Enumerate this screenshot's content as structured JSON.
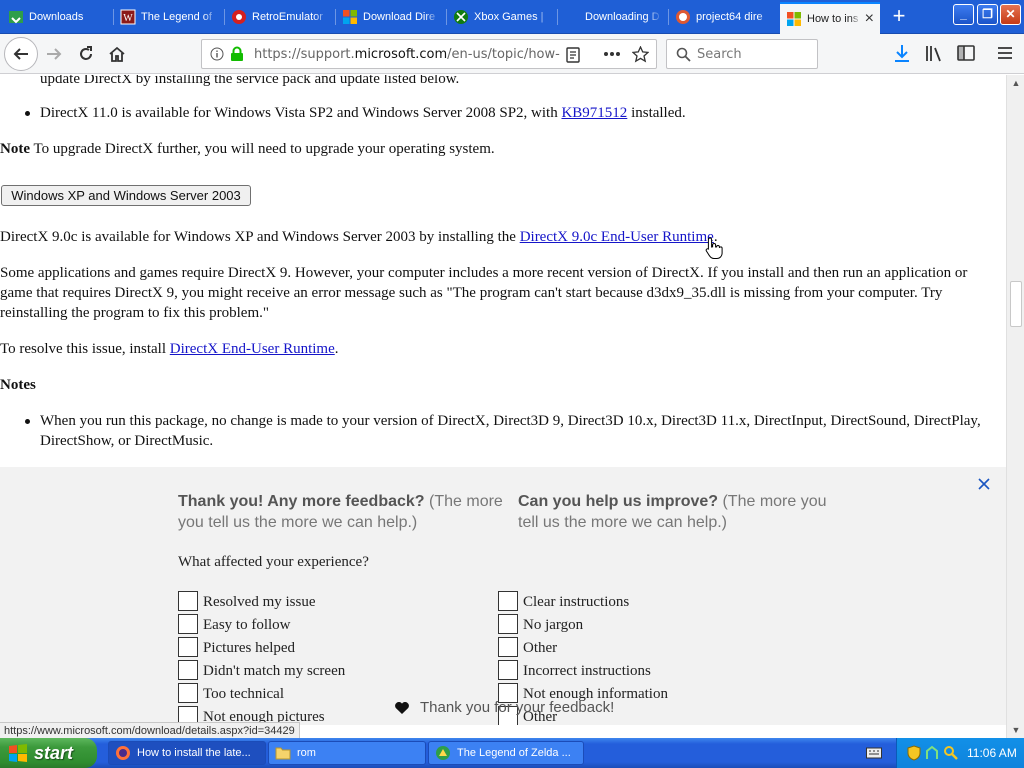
{
  "browser": {
    "tabs": [
      {
        "label": "Downloads",
        "icon": "downloads-favicon"
      },
      {
        "label": "The Legend of",
        "icon": "zelda-favicon"
      },
      {
        "label": "RetroEmulator",
        "icon": "retroemulator-favicon"
      },
      {
        "label": "Download Dire",
        "icon": "microsoft-favicon"
      },
      {
        "label": "Xbox Games |",
        "icon": "xbox-favicon"
      },
      {
        "label": "Downloading D",
        "icon": "blank-favicon"
      },
      {
        "label": "project64 dire",
        "icon": "duckduckgo-favicon"
      },
      {
        "label": "How to ins",
        "icon": "microsoft-favicon",
        "active": true
      }
    ],
    "tab_close": "×",
    "new_tab": "+",
    "window_buttons": {
      "minimize": "_",
      "maximize": "❐",
      "close": "✕"
    },
    "url_prefix": "https://support.",
    "url_domain": "microsoft.com",
    "url_path": "/en-us/topic/how-",
    "search_placeholder": "Search"
  },
  "page": {
    "top_cut_line": "update DirectX by installing the service pack and update listed below.",
    "bullet1_text": "DirectX 11.0 is available for Windows Vista SP2 and Windows Server 2008 SP2, with ",
    "bullet1_link": "KB971512",
    "bullet1_tail": " installed.",
    "note_label": "Note",
    "note_text": " To upgrade DirectX further, you will need to upgrade your operating system.",
    "xp_button": "Windows XP and Windows Server 2003",
    "dx9_text": "DirectX 9.0c is available for Windows XP and Windows Server 2003 by installing the ",
    "dx9_link": "DirectX 9.0c End-User Runtime",
    "dx9_tail": ".",
    "some_apps": "Some applications and games require DirectX 9. However, your computer includes a more recent version of DirectX. If you install and then run an application or game that requires DirectX 9, you might receive an error message such as \"The program can't start because d3dx9_35.dll is missing from your computer. Try reinstalling the program to fix this problem.\"",
    "resolve_text": "To resolve this issue, install ",
    "resolve_link": "DirectX End-User Runtime",
    "resolve_tail": ".",
    "notes_heading": "Notes",
    "notes_bullet": "When you run this package, no change is made to your version of DirectX, Direct3D 9, Direct3D 10.x, Direct3D 11.x, DirectInput, DirectSound, DirectPlay, DirectShow, or DirectMusic."
  },
  "feedback": {
    "left_bold": "Thank you! Any more feedback?",
    "left_rest": " (The more you tell us the more we can help.)",
    "right_bold": "Can you help us improve?",
    "right_rest": " (The more you tell us the more we can help.)",
    "question": "What affected your experience?",
    "left_options": [
      "Resolved my issue",
      "Easy to follow",
      "Pictures helped",
      "Didn't match my screen",
      "Too technical",
      "Not enough pictures"
    ],
    "right_options": [
      "Clear instructions",
      "No jargon",
      "Other",
      "Incorrect instructions",
      "Not enough information",
      "Other"
    ],
    "thanks": "Thank you for your feedback!"
  },
  "status_link": "https://www.microsoft.com/download/details.aspx?id=34429",
  "taskbar": {
    "start": "start",
    "tasks": [
      {
        "label": "How to install the late...",
        "icon": "firefox-icon"
      },
      {
        "label": "rom",
        "icon": "folder-icon"
      },
      {
        "label": "The Legend of Zelda ...",
        "icon": "zelda-window-icon"
      }
    ],
    "clock": "11:06 AM"
  },
  "colors": {
    "tabbar": "#1f5fd6",
    "link": "#1515c9",
    "taskbar": "#245edb",
    "start_green": "#3c9a3c",
    "feedback_bg": "#f2f2f2"
  }
}
